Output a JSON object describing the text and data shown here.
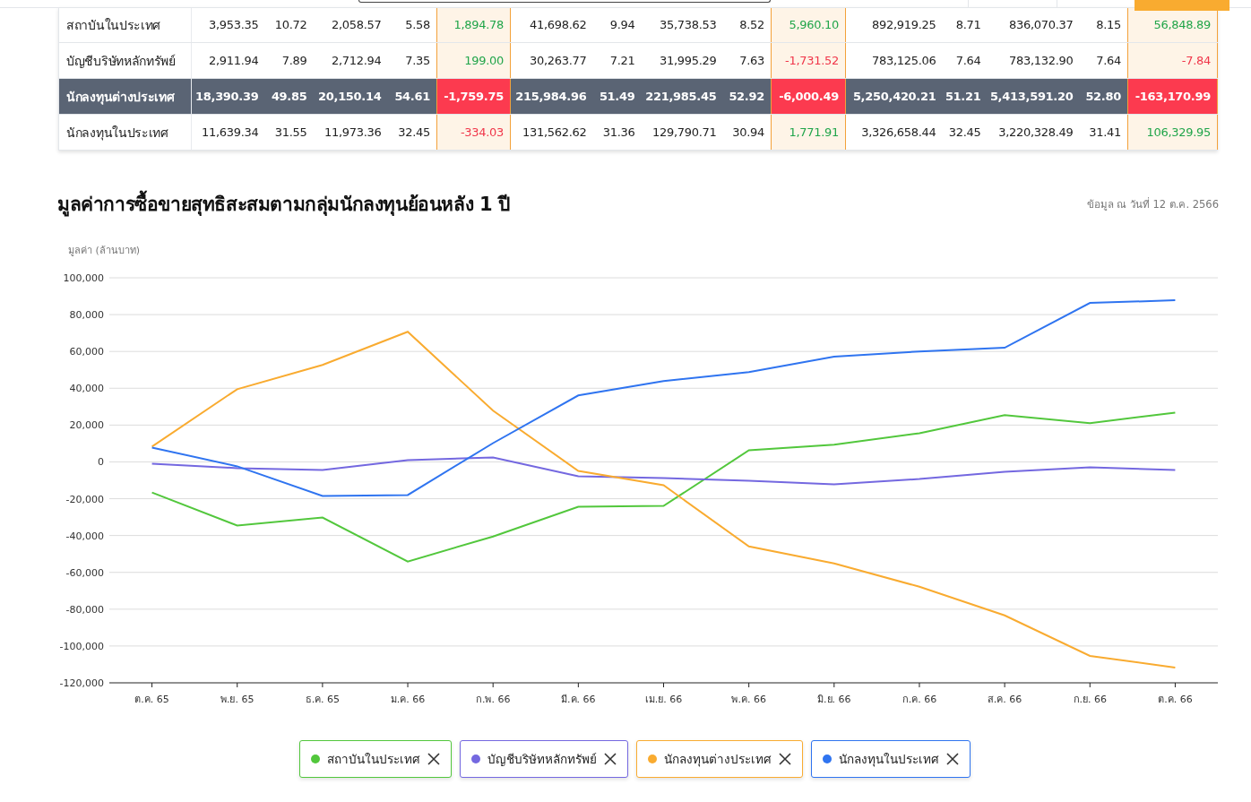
{
  "table": {
    "rows": [
      {
        "name": "สถาบันในประเทศ",
        "selected": false,
        "cells": [
          {
            "text": "3,953.35",
            "kind": "plain"
          },
          {
            "text": "10.72",
            "kind": "plain"
          },
          {
            "text": "2,058.57",
            "kind": "plain"
          },
          {
            "text": "5.58",
            "kind": "plain"
          },
          {
            "text": "1,894.78",
            "kind": "gain"
          },
          {
            "text": "41,698.62",
            "kind": "plain"
          },
          {
            "text": "9.94",
            "kind": "plain"
          },
          {
            "text": "35,738.53",
            "kind": "plain"
          },
          {
            "text": "8.52",
            "kind": "plain"
          },
          {
            "text": "5,960.10",
            "kind": "gain"
          },
          {
            "text": "892,919.25",
            "kind": "plain"
          },
          {
            "text": "8.71",
            "kind": "plain"
          },
          {
            "text": "836,070.37",
            "kind": "plain"
          },
          {
            "text": "8.15",
            "kind": "plain"
          },
          {
            "text": "56,848.89",
            "kind": "gain"
          }
        ]
      },
      {
        "name": "บัญชีบริษัทหลักทรัพย์",
        "selected": false,
        "cells": [
          {
            "text": "2,911.94",
            "kind": "plain"
          },
          {
            "text": "7.89",
            "kind": "plain"
          },
          {
            "text": "2,712.94",
            "kind": "plain"
          },
          {
            "text": "7.35",
            "kind": "plain"
          },
          {
            "text": "199.00",
            "kind": "gain"
          },
          {
            "text": "30,263.77",
            "kind": "plain"
          },
          {
            "text": "7.21",
            "kind": "plain"
          },
          {
            "text": "31,995.29",
            "kind": "plain"
          },
          {
            "text": "7.63",
            "kind": "plain"
          },
          {
            "text": "-1,731.52",
            "kind": "loss"
          },
          {
            "text": "783,125.06",
            "kind": "plain"
          },
          {
            "text": "7.64",
            "kind": "plain"
          },
          {
            "text": "783,132.90",
            "kind": "plain"
          },
          {
            "text": "7.64",
            "kind": "plain"
          },
          {
            "text": "-7.84",
            "kind": "loss"
          }
        ]
      },
      {
        "name": "นักลงทุนต่างประเทศ",
        "selected": true,
        "cells": [
          {
            "text": "18,390.39",
            "kind": "plain"
          },
          {
            "text": "49.85",
            "kind": "plain"
          },
          {
            "text": "20,150.14",
            "kind": "plain"
          },
          {
            "text": "54.61",
            "kind": "plain"
          },
          {
            "text": "-1,759.75",
            "kind": "loss"
          },
          {
            "text": "215,984.96",
            "kind": "plain"
          },
          {
            "text": "51.49",
            "kind": "plain"
          },
          {
            "text": "221,985.45",
            "kind": "plain"
          },
          {
            "text": "52.92",
            "kind": "plain"
          },
          {
            "text": "-6,000.49",
            "kind": "loss"
          },
          {
            "text": "5,250,420.21",
            "kind": "plain"
          },
          {
            "text": "51.21",
            "kind": "plain"
          },
          {
            "text": "5,413,591.20",
            "kind": "plain"
          },
          {
            "text": "52.80",
            "kind": "plain"
          },
          {
            "text": "-163,170.99",
            "kind": "loss"
          }
        ]
      },
      {
        "name": "นักลงทุนในประเทศ",
        "selected": false,
        "cells": [
          {
            "text": "11,639.34",
            "kind": "plain"
          },
          {
            "text": "31.55",
            "kind": "plain"
          },
          {
            "text": "11,973.36",
            "kind": "plain"
          },
          {
            "text": "32.45",
            "kind": "plain"
          },
          {
            "text": "-334.03",
            "kind": "loss"
          },
          {
            "text": "131,562.62",
            "kind": "plain"
          },
          {
            "text": "31.36",
            "kind": "plain"
          },
          {
            "text": "129,790.71",
            "kind": "plain"
          },
          {
            "text": "30.94",
            "kind": "plain"
          },
          {
            "text": "1,771.91",
            "kind": "gain"
          },
          {
            "text": "3,326,658.44",
            "kind": "plain"
          },
          {
            "text": "32.45",
            "kind": "plain"
          },
          {
            "text": "3,220,328.49",
            "kind": "plain"
          },
          {
            "text": "31.41",
            "kind": "plain"
          },
          {
            "text": "106,329.95",
            "kind": "gain"
          }
        ]
      }
    ]
  },
  "chart": {
    "title": "มูลค่าการซื้อขายสุทธิสะสมตามกลุ่มนักลงทุนย้อนหลัง 1 ปี",
    "date_note": "ข้อมูล ณ วันที่ 12 ต.ค. 2566",
    "chart_data": {
      "type": "line",
      "grid": true,
      "ylabel": "มูลค่า (ล้านบาท)",
      "categories": [
        "ต.ค. 65",
        "พ.ย. 65",
        "ธ.ค. 65",
        "ม.ค. 66",
        "ก.พ. 66",
        "มี.ค. 66",
        "เม.ย. 66",
        "พ.ค. 66",
        "มิ.ย. 66",
        "ก.ค. 66",
        "ส.ค. 66",
        "ก.ย. 66",
        "ต.ค. 66"
      ],
      "ylim": [
        -120000,
        100000
      ],
      "yticks": [
        {
          "value": 100000,
          "label": "100,000"
        },
        {
          "value": 80000,
          "label": "80,000"
        },
        {
          "value": 60000,
          "label": "60,000"
        },
        {
          "value": 40000,
          "label": "40,000"
        },
        {
          "value": 20000,
          "label": "20,000"
        },
        {
          "value": 0,
          "label": "0"
        },
        {
          "value": -20000,
          "label": "-20,000"
        },
        {
          "value": -40000,
          "label": "-40,000"
        },
        {
          "value": -60000,
          "label": "-60,000"
        },
        {
          "value": -80000,
          "label": "-80,000"
        },
        {
          "value": -100000,
          "label": "-100,000"
        },
        {
          "value": -120000,
          "label": "-120,000"
        }
      ],
      "series": [
        {
          "name": "สถาบันในประเทศ",
          "color": "#52c73c",
          "values": [
            -16600,
            -34600,
            -30200,
            -54100,
            -40500,
            -24400,
            -23900,
            6300,
            9300,
            15600,
            25400,
            21000,
            26800
          ]
        },
        {
          "name": "บัญชีบริษัทหลักทรัพย์",
          "color": "#7468e0",
          "values": [
            -1000,
            -3400,
            -4400,
            1000,
            2400,
            -7800,
            -8800,
            -10200,
            -12200,
            -9300,
            -5400,
            -2900,
            -4400
          ]
        },
        {
          "name": "นักลงทุนต่างประเทศ",
          "color": "#f9ab30",
          "values": [
            8300,
            39500,
            52700,
            70700,
            27800,
            -4900,
            -12700,
            -45900,
            -55100,
            -67800,
            -83400,
            -105400,
            -111700
          ]
        },
        {
          "name": "นักลงทุนในประเทศ",
          "color": "#2f74f0",
          "values": [
            7800,
            -2400,
            -18500,
            -18000,
            10200,
            36100,
            43900,
            48800,
            57100,
            60000,
            62000,
            86300,
            87800
          ]
        }
      ]
    }
  }
}
